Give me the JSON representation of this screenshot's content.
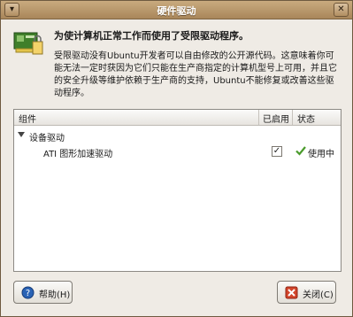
{
  "window": {
    "title": "硬件驱动",
    "menu_icon": "down-arrow-icon",
    "close_icon": "close-icon"
  },
  "header": {
    "title": "为使计算机正常工作而使用了受限驱动程序。",
    "description": "受限驱动没有Ubuntu开发者可以自由修改的公开源代码。这意味着你可能无法一定时获因为它们只能在生产商指定的计算机型号上可用，并且它的安全升级等维护依赖于生产商的支持，Ubuntu不能修复或改善这些驱动程序。"
  },
  "table": {
    "columns": [
      "组件",
      "已启用",
      "状态"
    ],
    "group": {
      "label": "设备驱动"
    },
    "rows": [
      {
        "name": "ATI 图形加速驱动",
        "enabled": true,
        "status": "使用中"
      }
    ]
  },
  "buttons": {
    "help_label": "帮助(H)",
    "close_label": "关闭(C)"
  },
  "colors": {
    "titlebar": "#b08d61",
    "window_bg": "#efebe5",
    "accent_green": "#4a9b2c",
    "close_red": "#d2452b",
    "help_blue": "#2a63b5"
  }
}
